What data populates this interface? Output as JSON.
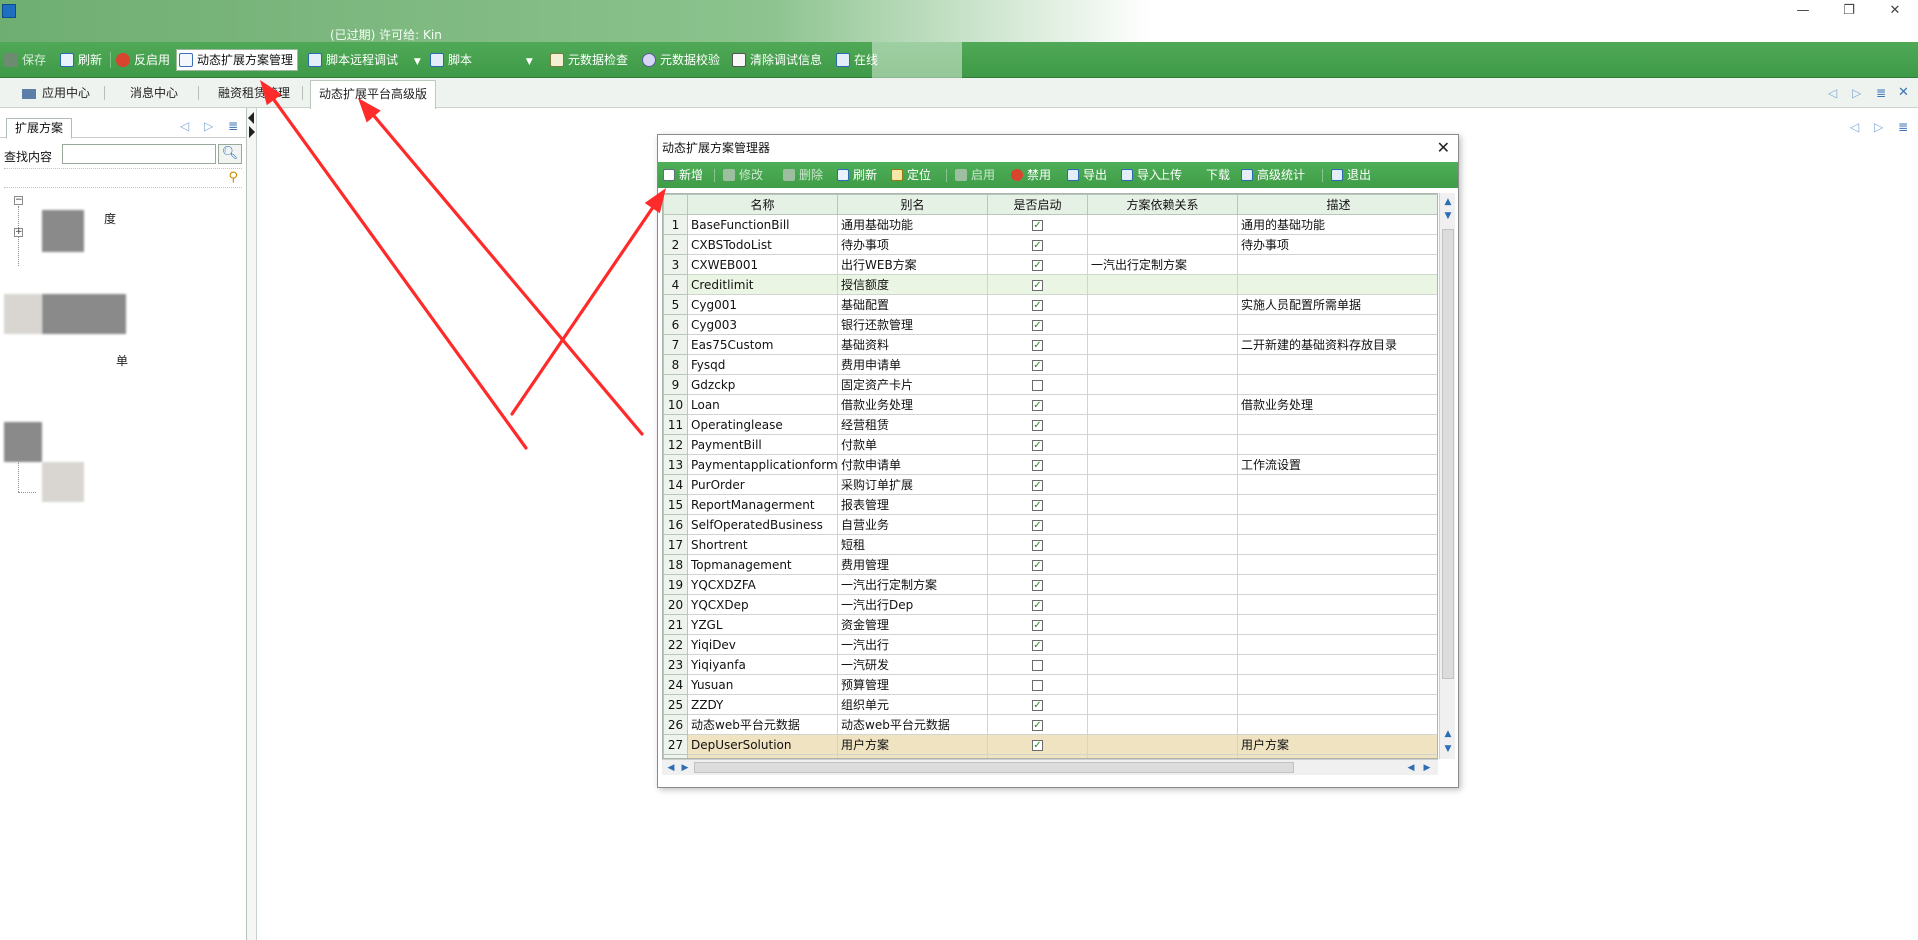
{
  "window": {
    "title_fragment": "(已过期) 许可给: Kin",
    "controls": {
      "minimize": "—",
      "restore": "❐",
      "close": "✕"
    }
  },
  "toolbar": {
    "items": [
      {
        "label": "保存",
        "icon": "save-icon",
        "dim": true
      },
      {
        "label": "刷新",
        "icon": "refresh-icon"
      },
      {
        "label": "反启用",
        "icon": "disable-icon"
      },
      {
        "label": "动态扩展方案管理",
        "icon": "scheme-manager-icon",
        "active": true
      },
      {
        "label": "脚本远程调试",
        "icon": "script-debug-icon",
        "dropdown": true
      },
      {
        "label": "脚本",
        "icon": "script-icon",
        "dropdown": true
      },
      {
        "label": "元数据检查",
        "icon": "metadata-check-icon"
      },
      {
        "label": "元数据校验",
        "icon": "metadata-verify-icon"
      },
      {
        "label": "清除调试信息",
        "icon": "clear-debug-icon"
      },
      {
        "label": "在线",
        "icon": "online-icon"
      }
    ]
  },
  "tabs": [
    {
      "label": "应用中心",
      "icon": "app-center-icon"
    },
    {
      "label": "消息中心"
    },
    {
      "label": "融资租赁管理"
    },
    {
      "label": "动态扩展平台高级版",
      "active": true
    }
  ],
  "left_panel": {
    "tab_label": "扩展方案",
    "search_label": "查找内容",
    "search_value": "",
    "tree_fragments": [
      "度",
      "单"
    ]
  },
  "dialog": {
    "title": "动态扩展方案管理器",
    "close": "✕",
    "toolbar": [
      {
        "label": "新增",
        "icon": "new-icon"
      },
      {
        "label": "修改",
        "icon": "edit-icon",
        "dim": true
      },
      {
        "label": "删除",
        "icon": "delete-icon",
        "dim": true
      },
      {
        "label": "刷新",
        "icon": "refresh-icon"
      },
      {
        "label": "定位",
        "icon": "locate-icon"
      },
      {
        "label": "启用",
        "icon": "enable-icon",
        "dim": true
      },
      {
        "label": "禁用",
        "icon": "ban-icon"
      },
      {
        "label": "导出",
        "icon": "export-icon"
      },
      {
        "label": "导入",
        "icon": "import-icon"
      },
      {
        "label": "上传",
        "icon": ""
      },
      {
        "label": "下载",
        "icon": ""
      },
      {
        "label": "高级统计",
        "icon": "statistics-icon"
      },
      {
        "label": "退出",
        "icon": "exit-icon"
      }
    ],
    "grid": {
      "columns": [
        "名称",
        "别名",
        "是否启动",
        "方案依赖关系",
        "描述"
      ],
      "rows": [
        {
          "n": "1",
          "name": "BaseFunctionBill",
          "alias": "通用基础功能",
          "enabled": true,
          "dep": "",
          "desc": "通用的基础功能"
        },
        {
          "n": "2",
          "name": "CXBSTodoList",
          "alias": "待办事项",
          "enabled": true,
          "dep": "",
          "desc": "待办事项"
        },
        {
          "n": "3",
          "name": "CXWEB001",
          "alias": "出行WEB方案",
          "enabled": true,
          "dep": "一汽出行定制方案",
          "desc": ""
        },
        {
          "n": "4",
          "name": "Creditlimit",
          "alias": "授信额度",
          "enabled": true,
          "dep": "",
          "desc": "",
          "state": "sel"
        },
        {
          "n": "5",
          "name": "Cyg001",
          "alias": "基础配置",
          "enabled": true,
          "dep": "",
          "desc": "实施人员配置所需单据"
        },
        {
          "n": "6",
          "name": "Cyg003",
          "alias": "银行还款管理",
          "enabled": true,
          "dep": "",
          "desc": ""
        },
        {
          "n": "7",
          "name": "Eas75Custom",
          "alias": "基础资料",
          "enabled": true,
          "dep": "",
          "desc": "二开新建的基础资料存放目录"
        },
        {
          "n": "8",
          "name": "Fysqd",
          "alias": "费用申请单",
          "enabled": true,
          "dep": "",
          "desc": ""
        },
        {
          "n": "9",
          "name": "Gdzckp",
          "alias": "固定资产卡片",
          "enabled": false,
          "dep": "",
          "desc": ""
        },
        {
          "n": "10",
          "name": "Loan",
          "alias": "借款业务处理",
          "enabled": true,
          "dep": "",
          "desc": "借款业务处理"
        },
        {
          "n": "11",
          "name": "Operatinglease",
          "alias": "经营租赁",
          "enabled": true,
          "dep": "",
          "desc": ""
        },
        {
          "n": "12",
          "name": "PaymentBill",
          "alias": "付款单",
          "enabled": true,
          "dep": "",
          "desc": ""
        },
        {
          "n": "13",
          "name": "Paymentapplicationform",
          "alias": "付款申请单",
          "enabled": true,
          "dep": "",
          "desc": "工作流设置"
        },
        {
          "n": "14",
          "name": "PurOrder",
          "alias": "采购订单扩展",
          "enabled": true,
          "dep": "",
          "desc": ""
        },
        {
          "n": "15",
          "name": "ReportManagerment",
          "alias": "报表管理",
          "enabled": true,
          "dep": "",
          "desc": ""
        },
        {
          "n": "16",
          "name": "SelfOperatedBusiness",
          "alias": "自营业务",
          "enabled": true,
          "dep": "",
          "desc": ""
        },
        {
          "n": "17",
          "name": "Shortrent",
          "alias": "短租",
          "enabled": true,
          "dep": "",
          "desc": ""
        },
        {
          "n": "18",
          "name": "Topmanagement",
          "alias": "费用管理",
          "enabled": true,
          "dep": "",
          "desc": ""
        },
        {
          "n": "19",
          "name": "YQCXDZFA",
          "alias": "一汽出行定制方案",
          "enabled": true,
          "dep": "",
          "desc": ""
        },
        {
          "n": "20",
          "name": "YQCXDep",
          "alias": "一汽出行Dep",
          "enabled": true,
          "dep": "",
          "desc": ""
        },
        {
          "n": "21",
          "name": "YZGL",
          "alias": "资金管理",
          "enabled": true,
          "dep": "",
          "desc": ""
        },
        {
          "n": "22",
          "name": "YiqiDev",
          "alias": "一汽出行",
          "enabled": true,
          "dep": "",
          "desc": ""
        },
        {
          "n": "23",
          "name": "Yiqiyanfa",
          "alias": "一汽研发",
          "enabled": false,
          "dep": "",
          "desc": ""
        },
        {
          "n": "24",
          "name": "Yusuan",
          "alias": "预算管理",
          "enabled": false,
          "dep": "",
          "desc": ""
        },
        {
          "n": "25",
          "name": "ZZDY",
          "alias": "组织单元",
          "enabled": true,
          "dep": "",
          "desc": ""
        },
        {
          "n": "26",
          "name": "动态web平台元数据",
          "alias": "动态web平台元数据",
          "enabled": true,
          "dep": "",
          "desc": ""
        },
        {
          "n": "27",
          "name": "DepUserSolution",
          "alias": "用户方案",
          "enabled": true,
          "dep": "",
          "desc": "用户方案",
          "state": "hl"
        }
      ]
    }
  },
  "annotation_color": "#ff2a2a"
}
